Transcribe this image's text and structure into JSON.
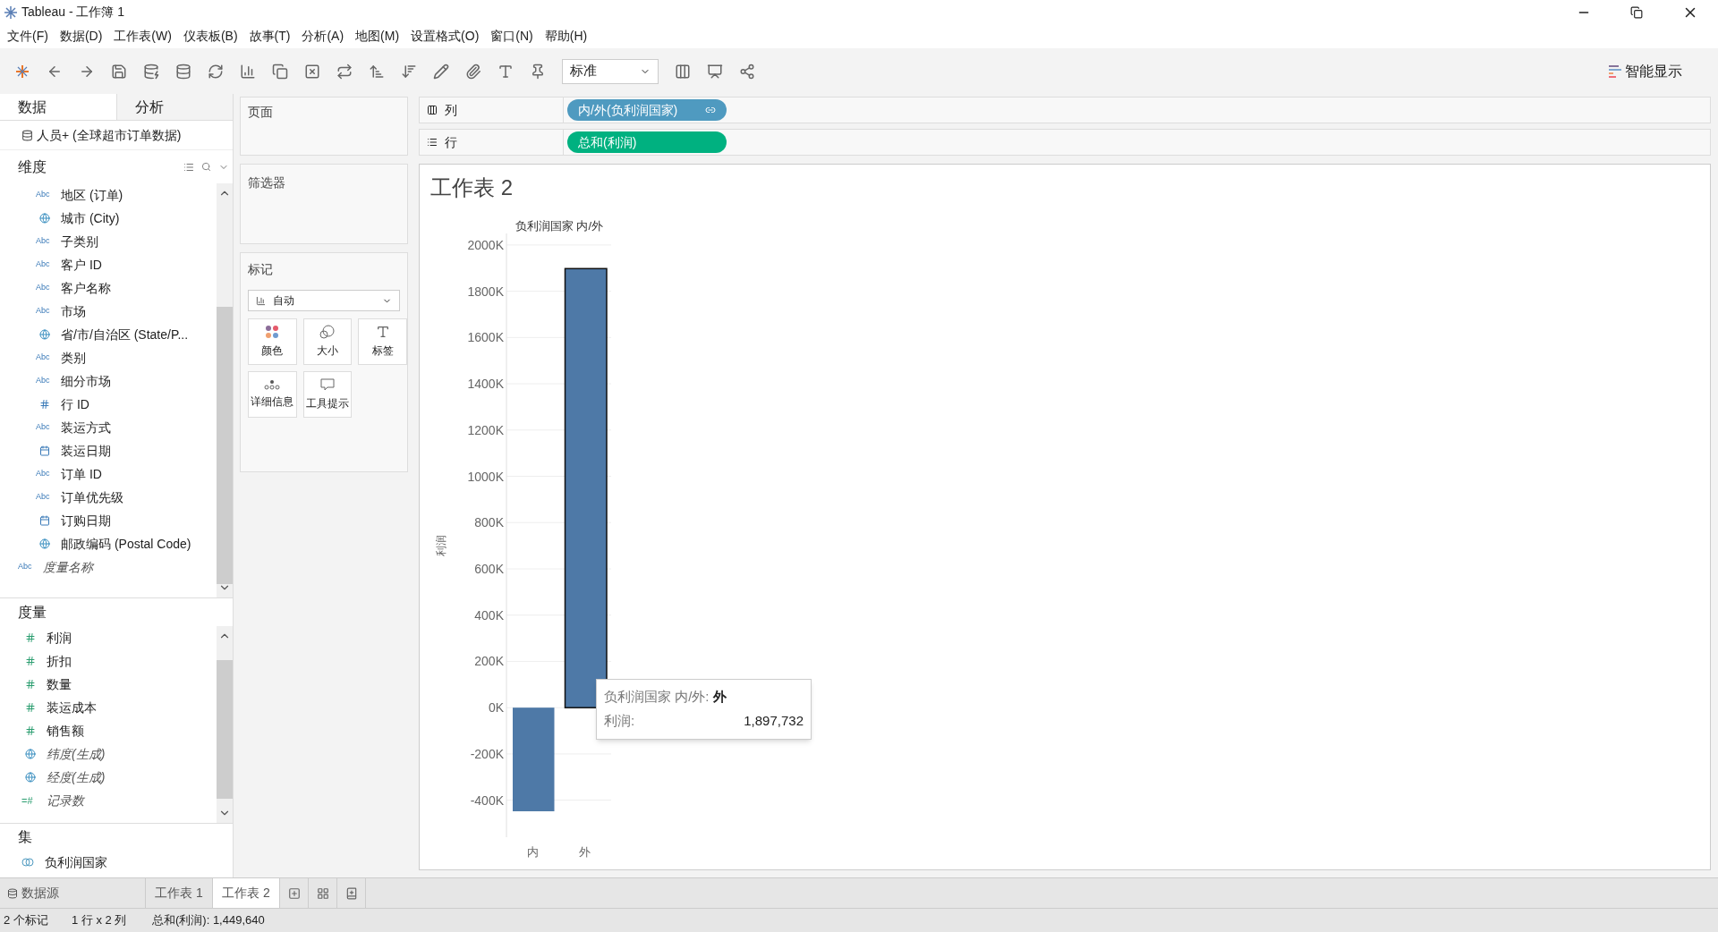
{
  "window": {
    "title": "Tableau - 工作簿 1"
  },
  "menu": [
    "文件(F)",
    "数据(D)",
    "工作表(W)",
    "仪表板(B)",
    "故事(T)",
    "分析(A)",
    "地图(M)",
    "设置格式(O)",
    "窗口(N)",
    "帮助(H)"
  ],
  "toolbar": {
    "fit": "标准",
    "show_me": "智能显示"
  },
  "data_pane": {
    "tabs": [
      {
        "label": "数据",
        "selected": true
      },
      {
        "label": "分析",
        "selected": false
      }
    ],
    "data_source": "人员+ (全球超市订单数据)",
    "dimensions": {
      "title": "维度",
      "items": [
        {
          "kind": "text",
          "label": "地区 (订单)",
          "italic": false,
          "type_label": "Abc"
        },
        {
          "kind": "geo",
          "label": "城市 (City)",
          "italic": false
        },
        {
          "kind": "text",
          "label": "子类别",
          "italic": false,
          "type_label": "Abc"
        },
        {
          "kind": "text",
          "label": "客户 ID",
          "italic": false,
          "type_label": "Abc"
        },
        {
          "kind": "text",
          "label": "客户名称",
          "italic": false,
          "type_label": "Abc"
        },
        {
          "kind": "text",
          "label": "市场",
          "italic": false,
          "type_label": "Abc"
        },
        {
          "kind": "geo",
          "label": "省/市/自治区 (State/P...",
          "italic": false
        },
        {
          "kind": "text",
          "label": "类别",
          "italic": false,
          "type_label": "Abc"
        },
        {
          "kind": "text",
          "label": "细分市场",
          "italic": false,
          "type_label": "Abc"
        },
        {
          "kind": "number",
          "label": "行 ID",
          "italic": false
        },
        {
          "kind": "text",
          "label": "装运方式",
          "italic": false,
          "type_label": "Abc"
        },
        {
          "kind": "date",
          "label": "装运日期",
          "italic": false
        },
        {
          "kind": "text",
          "label": "订单 ID",
          "italic": false,
          "type_label": "Abc"
        },
        {
          "kind": "text",
          "label": "订单优先级",
          "italic": false,
          "type_label": "Abc"
        },
        {
          "kind": "date",
          "label": "订购日期",
          "italic": false
        },
        {
          "kind": "geo",
          "label": "邮政编码 (Postal Code)",
          "italic": false
        }
      ],
      "extra": {
        "kind": "text",
        "label": "度量名称",
        "italic": true,
        "type_label": "Abc"
      }
    },
    "measures": {
      "title": "度量",
      "items": [
        {
          "kind": "number",
          "label": "利润",
          "italic": false
        },
        {
          "kind": "number",
          "label": "折扣",
          "italic": false
        },
        {
          "kind": "number",
          "label": "数量",
          "italic": false
        },
        {
          "kind": "number",
          "label": "装运成本",
          "italic": false
        },
        {
          "kind": "number",
          "label": "销售额",
          "italic": false
        },
        {
          "kind": "geo",
          "label": "纬度(生成)",
          "italic": true
        },
        {
          "kind": "geo",
          "label": "经度(生成)",
          "italic": true
        },
        {
          "kind": "calc",
          "label": "记录数",
          "italic": true,
          "type_label": "=#"
        }
      ]
    },
    "sets": {
      "title": "集",
      "items": [
        {
          "label": "负利润国家"
        }
      ]
    }
  },
  "shelves": {
    "pages": "页面",
    "filters": "筛选器",
    "marks": {
      "title": "标记",
      "type": "自动",
      "cards": [
        {
          "kind": "color",
          "label": "颜色"
        },
        {
          "kind": "size",
          "label": "大小"
        },
        {
          "kind": "label",
          "label": "标签"
        },
        {
          "kind": "detail",
          "label": "详细信息"
        },
        {
          "kind": "tooltip",
          "label": "工具提示"
        }
      ]
    }
  },
  "columns_shelf": {
    "label": "列",
    "pill": {
      "kind": "dimension",
      "text": "内/外(负利润国家)"
    }
  },
  "rows_shelf": {
    "label": "行",
    "pill": {
      "kind": "measure",
      "text": "总和(利润)"
    }
  },
  "sheet": {
    "title": "工作表 2",
    "chart_data": {
      "type": "bar",
      "title": "负利润国家 内/外",
      "ylabel": "利润",
      "categories": [
        "内",
        "外"
      ],
      "series": [
        {
          "color": "#4e79a7",
          "values": [
            -448000,
            1898000
          ]
        }
      ],
      "grid": true,
      "ylim": [
        -560000,
        2050000
      ],
      "yticks": [
        {
          "value": 2000000,
          "label": "2000K"
        },
        {
          "value": 1800000,
          "label": "1800K"
        },
        {
          "value": 1600000,
          "label": "1600K"
        },
        {
          "value": 1400000,
          "label": "1400K"
        },
        {
          "value": 1200000,
          "label": "1200K"
        },
        {
          "value": 1000000,
          "label": "1000K"
        },
        {
          "value": 800000,
          "label": "800K"
        },
        {
          "value": 600000,
          "label": "600K"
        },
        {
          "value": 400000,
          "label": "400K"
        },
        {
          "value": 200000,
          "label": "200K"
        },
        {
          "value": 0,
          "label": "0K"
        },
        {
          "value": -200000,
          "label": "-200K"
        },
        {
          "value": -400000,
          "label": "-400K"
        }
      ]
    },
    "selected": [
      false,
      true
    ],
    "tooltip": {
      "rows": [
        {
          "label": "负利润国家 内/外:",
          "value": "外",
          "bold": true
        },
        {
          "label": "利润:",
          "value": "1,897,732",
          "bold": false
        }
      ]
    }
  },
  "sheet_tabs": {
    "data_source": "数据源",
    "tabs": [
      {
        "label": "工作表 1",
        "selected": false
      },
      {
        "label": "工作表 2",
        "selected": true
      }
    ]
  },
  "status_bar": [
    "2 个标记",
    "1 行 x 2 列",
    "总和(利润): 1,449,640"
  ]
}
